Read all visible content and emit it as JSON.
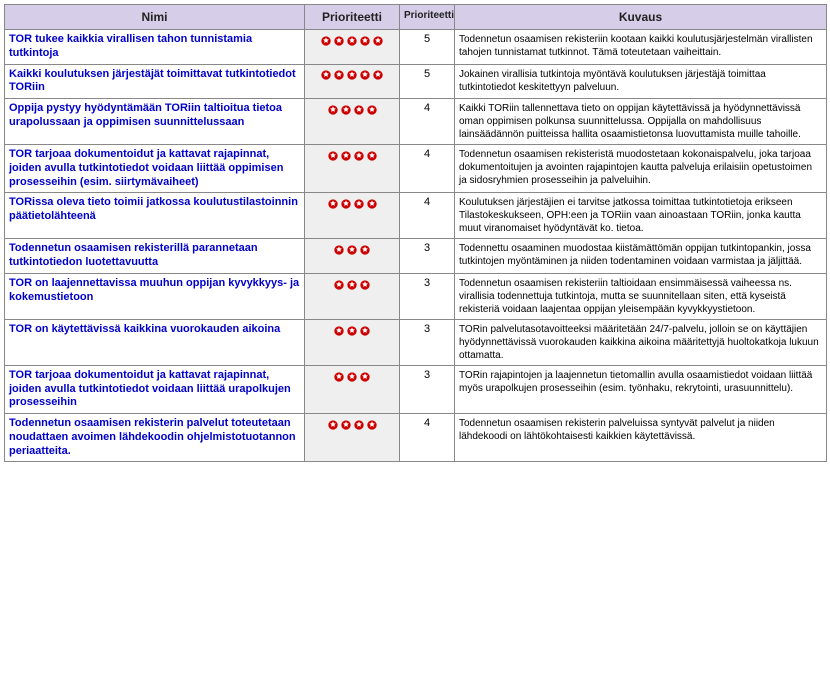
{
  "headers": {
    "name": "Nimi",
    "priority_icons": "Prioriteetti",
    "priority_num": "Prioriteetti",
    "description": "Kuvaus"
  },
  "rows": [
    {
      "name": "TOR tukee kaikkia virallisen tahon tunnistamia tutkintoja",
      "priority": 5,
      "description": "Todennetun osaamisen rekisteriin kootaan kaikki koulutusjärjestelmän virallisten tahojen tunnistamat tutkinnot. Tämä toteutetaan vaiheittain."
    },
    {
      "name": "Kaikki koulutuksen järjestäjät toimittavat tutkintotiedot TORiin",
      "priority": 5,
      "description": "Jokainen virallisia tutkintoja myöntävä koulutuksen järjestäjä toimittaa tutkintotiedot keskitettyyn palveluun."
    },
    {
      "name": "Oppija pystyy hyödyntämään TORiin taltioitua tietoa urapolussaan ja oppimisen suunnittelussaan",
      "priority": 4,
      "description": "Kaikki TORiin tallennettava tieto on oppijan käytettävissä ja hyödynnettävissä oman oppimisen polkunsa suunnittelussa. Oppijalla on mahdollisuus lainsäädännön puitteissa hallita osaamistietonsa luovuttamista muille tahoille."
    },
    {
      "name": "TOR tarjoaa dokumentoidut ja kattavat rajapinnat, joiden avulla tutkintotiedot voidaan liittää oppimisen prosesseihin (esim. siirtymävaiheet)",
      "priority": 4,
      "description": "Todennetun osaamisen rekisteristä muodostetaan kokonaispalvelu, joka tarjoaa dokumentoitujen ja avointen rajapintojen kautta palveluja erilaisiin opetustoimen ja sidosryhmien prosesseihin ja palveluihin."
    },
    {
      "name": "TORissa oleva tieto toimii jatkossa koulutustilastoinnin päätietolähteenä",
      "priority": 4,
      "description": "Koulutuksen järjestäjien ei tarvitse jatkossa toimittaa tutkintotietoja erikseen Tilastokeskukseen, OPH:een ja TORiin vaan ainoastaan TORiin, jonka kautta muut viranomaiset hyödyntävät ko. tietoa."
    },
    {
      "name": "Todennetun osaamisen rekisterillä parannetaan tutkintotiedon luotettavuutta",
      "priority": 3,
      "description": "Todennettu osaaminen muodostaa kiistämättömän oppijan tutkintopankin, jossa tutkintojen myöntäminen ja niiden todentaminen voidaan varmistaa ja jäljittää."
    },
    {
      "name": "TOR on laajennettavissa muuhun oppijan kyvykkyys- ja kokemustietoon",
      "priority": 3,
      "description": "Todennetun osaamisen rekisteriin taltioidaan ensimmäisessä vaiheessa ns. virallisia todennettuja tutkintoja, mutta se suunnitellaan siten, että kyseistä rekisteriä voidaan laajentaa oppijan yleisempään kyvykkyystietoon."
    },
    {
      "name": "TOR on käytettävissä kaikkina vuorokauden aikoina",
      "priority": 3,
      "description": "TORin palvelutasotavoitteeksi määritetään 24/7-palvelu, jolloin se on käyttäjien hyödynnettävissä vuorokauden kaikkina aikoina määritettyjä huoltokatkoja lukuun ottamatta."
    },
    {
      "name": "TOR tarjoaa dokumentoidut ja kattavat rajapinnat, joiden avulla tutkintotiedot voidaan liittää urapolkujen prosesseihin",
      "priority": 3,
      "description": "TORin rajapintojen ja laajennetun tietomallin avulla osaamistiedot voidaan liittää myös urapolkujen prosesseihin (esim. työnhaku, rekrytointi, urasuunnittelu)."
    },
    {
      "name": "Todennetun osaamisen rekisterin palvelut toteutetaan noudattaen avoimen lähdekoodin ohjelmistotuotannon periaatteita.",
      "priority": 4,
      "description": "Todennetun osaamisen rekisterin palveluissa syntyvät palvelut ja niiden lähdekoodi on lähtökohtaisesti kaikkien käytettävissä."
    }
  ]
}
